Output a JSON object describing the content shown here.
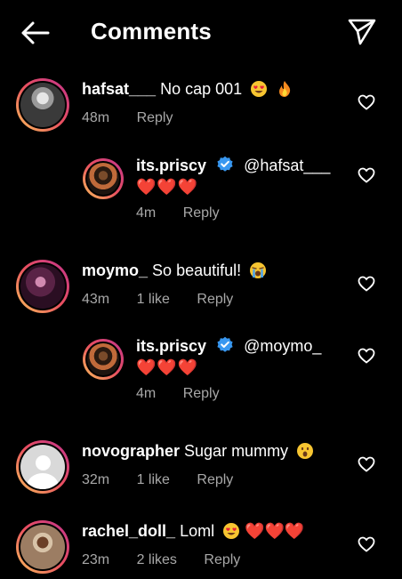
{
  "header": {
    "title": "Comments",
    "back_icon": "arrow-left-icon",
    "send_icon": "paper-plane-icon"
  },
  "comments": [
    {
      "username": "hafsat___",
      "text": "No cap 001",
      "emojis": [
        "smiling-face-with-heart-eyes",
        "fire"
      ],
      "time": "48m",
      "likes": "",
      "reply": "Reply"
    },
    {
      "username": "its.priscy",
      "verified": true,
      "mention": "@hafsat___",
      "text_line2": "❤️❤️❤️",
      "time": "4m",
      "likes": "",
      "reply": "Reply"
    },
    {
      "username": "moymo_",
      "text": "So beautiful!",
      "emojis": [
        "loudly-crying-face"
      ],
      "time": "43m",
      "likes": "1 like",
      "reply": "Reply"
    },
    {
      "username": "its.priscy",
      "verified": true,
      "mention": "@moymo_",
      "text_line2": "❤️❤️❤️",
      "time": "4m",
      "likes": "",
      "reply": "Reply"
    },
    {
      "username": "novographer",
      "text": "Sugar mummy",
      "emojis": [
        "face-with-open-mouth"
      ],
      "time": "32m",
      "likes": "1 like",
      "reply": "Reply"
    },
    {
      "username": "rachel_doll_",
      "text": "Loml",
      "emojis": [
        "smiling-face-with-heart-eyes"
      ],
      "hearts": "❤️❤️❤️",
      "time": "23m",
      "likes": "2 likes",
      "reply": "Reply"
    }
  ],
  "colors": {
    "accent_verified": "#3897f0",
    "heart_red": "#e8223b",
    "meta_gray": "#a8a8a8"
  }
}
